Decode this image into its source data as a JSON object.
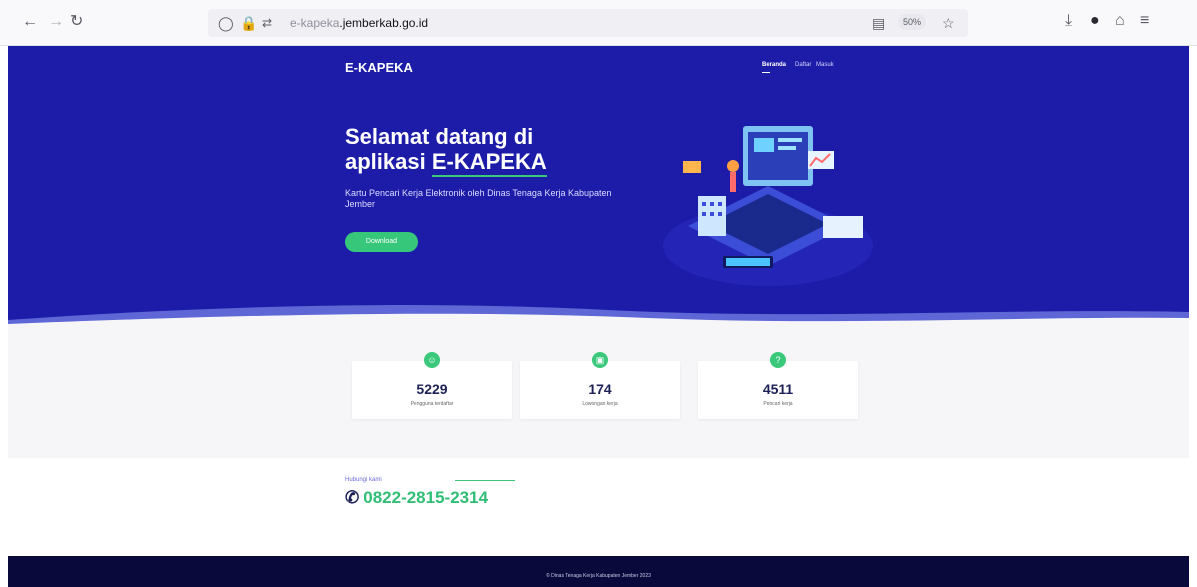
{
  "browser": {
    "url_prefix": "e-kapeka",
    "url_domain": ".jemberkab.go.id",
    "zoom": "50%",
    "icons": [
      "back-icon",
      "forward-icon",
      "reload-icon",
      "shield-icon",
      "lock-icon",
      "permissions-icon",
      "reader-view-icon",
      "bookmark-star-icon",
      "downloads-icon",
      "account-icon",
      "extensions-icon",
      "menu-icon"
    ]
  },
  "header": {
    "brand": "E-KAPEKA",
    "nav": [
      "Beranda",
      "Daftar",
      "Masuk"
    ]
  },
  "hero": {
    "title_line1": "Selamat datang di",
    "title_line2_prefix": "aplikasi ",
    "title_highlight": "E-KAPEKA",
    "subtitle": "Kartu Pencari Kerja Elektronik oleh Dinas Tenaga Kerja Kabupaten Jember",
    "download_label": "Download"
  },
  "stats": [
    {
      "value": "5229",
      "label": "Pengguna terdaftar"
    },
    {
      "value": "174",
      "label": "Lowongan kerja"
    },
    {
      "value": "4511",
      "label": "Pencari kerja"
    }
  ],
  "contact": {
    "label": "Hubungi kami",
    "phone": "0822-2815-2314"
  },
  "footer": {
    "text": "© Dinas Tenaga Kerja Kabupaten Jember 2023"
  },
  "colors": {
    "hero_bg": "#1c1ca8",
    "accent_green": "#37c77b",
    "footer_bg": "#090a3b",
    "number_text": "#1d2155"
  }
}
